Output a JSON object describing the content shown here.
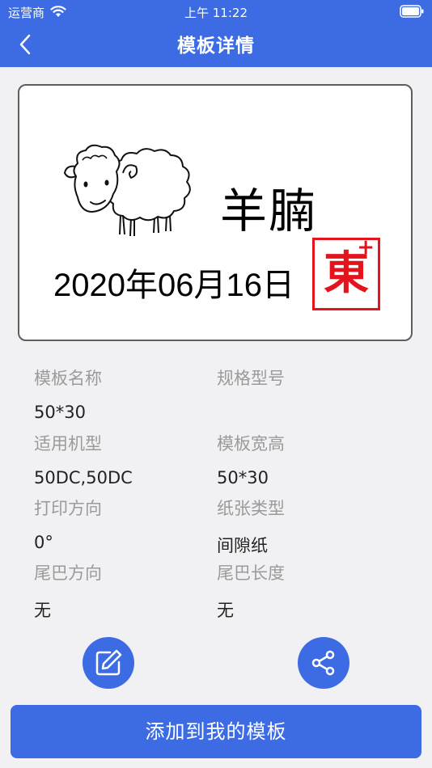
{
  "status_bar": {
    "carrier": "运营商",
    "time": "上午 11:22"
  },
  "header": {
    "title": "模板详情"
  },
  "label_preview": {
    "name": "羊腩",
    "date": "2020年06月16日"
  },
  "details": {
    "template_name": {
      "label": "模板名称",
      "value": "50*30"
    },
    "spec_model": {
      "label": "规格型号",
      "value": ""
    },
    "applicable_model": {
      "label": "适用机型",
      "value": "50DC,50DC"
    },
    "template_size": {
      "label": "模板宽高",
      "value": "50*30"
    },
    "print_direction": {
      "label": "打印方向",
      "value": "0°"
    },
    "paper_type": {
      "label": "纸张类型",
      "value": "间隙纸"
    },
    "tail_direction": {
      "label": "尾巴方向",
      "value": "无"
    },
    "tail_length": {
      "label": "尾巴长度",
      "value": "无"
    }
  },
  "actions": {
    "add_to_my_templates": "添加到我的模板"
  },
  "colors": {
    "primary": "#3c6be3",
    "stamp_red": "#e3141c",
    "background": "#f1f1f3"
  }
}
